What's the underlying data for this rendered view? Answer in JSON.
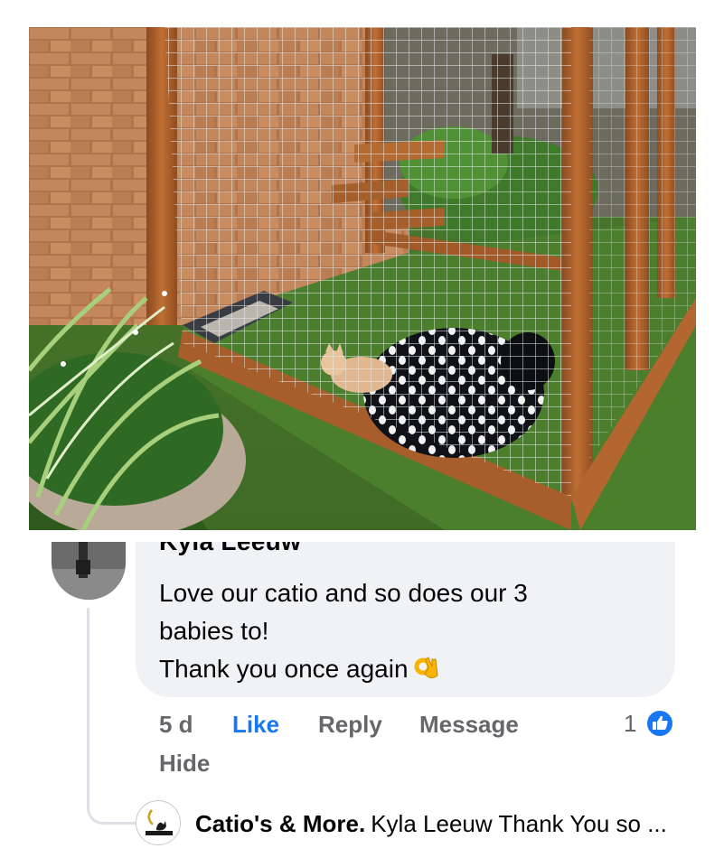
{
  "post": {
    "photo_description_icon": "catio-photo"
  },
  "comment": {
    "author_partial": "Kyla Leeuw",
    "text_line1": "Love our catio and so does our 3",
    "text_line2": "babies to!",
    "text_line3": "Thank you once again",
    "emoji": "ok-hand-emoji",
    "time": "5 d",
    "like_label": "Like",
    "reply_label": "Reply",
    "message_label": "Message",
    "hide_label": "Hide",
    "reaction_count": "1",
    "reaction_icon": "thumbs-up-icon",
    "colors": {
      "like": "#1877f2",
      "meta": "#65676b",
      "bubble": "#f0f2f5"
    }
  },
  "reply": {
    "author": "Catio's & More.",
    "text": "Kyla Leeuw Thank You so ...",
    "avatar_text": "Catio's & More"
  }
}
